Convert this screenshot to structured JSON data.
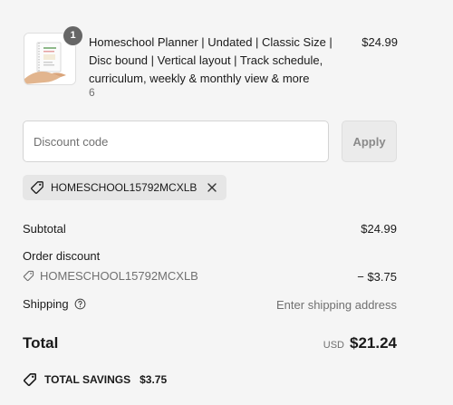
{
  "product": {
    "quantity_badge": "1",
    "title": "Homeschool Planner | Undated | Classic Size | Disc bound | Vertical layout | Track schedule, curriculum, weekly & monthly view & more",
    "variant": "6",
    "price": "$24.99"
  },
  "discount": {
    "placeholder": "Discount code",
    "apply_label": "Apply",
    "applied_code": "HOMESCHOOL15792MCXLB"
  },
  "summary": {
    "subtotal_label": "Subtotal",
    "subtotal_value": "$24.99",
    "order_discount_label": "Order discount",
    "order_discount_code": "HOMESCHOOL15792MCXLB",
    "order_discount_value": "− $3.75",
    "shipping_label": "Shipping",
    "shipping_value": "Enter shipping address",
    "total_label": "Total",
    "total_currency": "USD",
    "total_value": "$21.24",
    "savings_label": "TOTAL SAVINGS",
    "savings_value": "$3.75"
  },
  "icons": {
    "tag": "tag-icon",
    "close": "close-icon",
    "help": "question-circle-icon"
  },
  "colors": {
    "background": "#f5f5f5",
    "badge": "#666666",
    "muted_text": "#707070",
    "chip_background": "#e6e6e6"
  }
}
